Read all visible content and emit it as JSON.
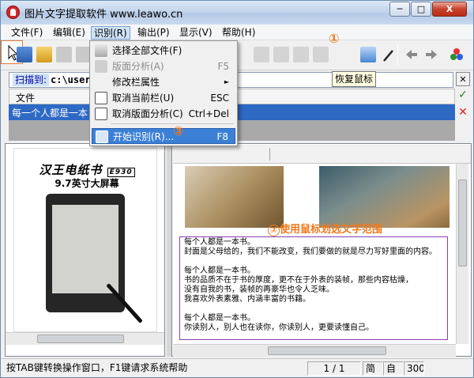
{
  "window": {
    "title": "图片文字提取软件 www.leawo.cn",
    "min_label": "─",
    "max_label": "□",
    "close_label": "X"
  },
  "menubar": {
    "items": [
      "文件(F)",
      "编辑(E)",
      "识别(R)",
      "输出(P)",
      "显示(V)",
      "帮助(H)"
    ]
  },
  "recognize_menu": {
    "items": [
      {
        "label": "选择全部文件(F)",
        "shortcut": "",
        "disabled": false
      },
      {
        "label": "版面分析(A)",
        "shortcut": "F5",
        "disabled": true
      },
      {
        "label": "修改栏属性",
        "shortcut": "►",
        "disabled": false
      },
      {
        "label": "取消当前栏(U)",
        "shortcut": "ESC",
        "disabled": false
      },
      {
        "label": "取消版面分析(C)",
        "shortcut": "Ctrl+Del",
        "disabled": false
      },
      {
        "label": "开始识别(R)...",
        "shortcut": "F8",
        "disabled": false,
        "highlighted": true
      }
    ]
  },
  "tooltip": {
    "text": "恢复鼠标"
  },
  "annotations": {
    "one": "①",
    "two": "②",
    "two_text": "使用鼠标划选文字范围",
    "three": "③"
  },
  "pathbar": {
    "label": "扫描到:",
    "path": "c:\\users"
  },
  "file_list": {
    "header": "文件",
    "selected_file": "每一个人都是一本"
  },
  "ad": {
    "title": "汉王电纸书",
    "model": "E930",
    "subtitle": "9.7英寸大屏幕"
  },
  "ocr_text": "每个人都是一本书。\n封面是父母给的，我们不能改变，我们要做的就是尽力写好里面的内容。\n\n每个人都是一本书。\n书的品质不在于书的厚度，更不在于外表的装帧，那些内容枯燥，\n没有自我的书，装帧的再豪华也令人乏味。\n我喜欢外表素雅、内涵丰富的书籍。\n\n每个人都是一本书。\n你读别人，别人也在读你，你读别人，更要读懂自己。",
  "status": {
    "hint": "按TAB键转换操作窗口，F1键请求系统帮助",
    "page": "1 / 1",
    "mode1": "简体",
    "mode2": "自动",
    "dpi": "300"
  },
  "colors": {
    "accent": "#3c80d6",
    "annotation": "#f07a1f",
    "selection": "#8a3fb0"
  }
}
